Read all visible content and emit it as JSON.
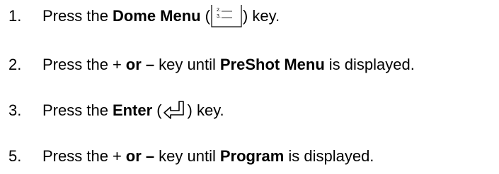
{
  "steps": [
    {
      "number": "1.",
      "before": "Press the",
      "bold": "Dome Menu",
      "open_paren": "(",
      "icon": "dome-menu-icon",
      "icon_lines": [
        "2.",
        "3."
      ],
      "after": ") key."
    },
    {
      "number": "2.",
      "before": "Press the",
      "plus": "+",
      "bold_or": "or –",
      "middle": "key until",
      "bold": "PreShot Menu",
      "after": "is displayed."
    },
    {
      "number": "3.",
      "before": "Press the",
      "bold": "Enter",
      "open_paren": "(",
      "icon": "enter-key-icon",
      "after": ") key."
    },
    {
      "number": "5.",
      "before": "Press the",
      "plus": "+",
      "bold_or": "or –",
      "middle": "key until",
      "bold": "Program",
      "after": "is displayed."
    }
  ]
}
